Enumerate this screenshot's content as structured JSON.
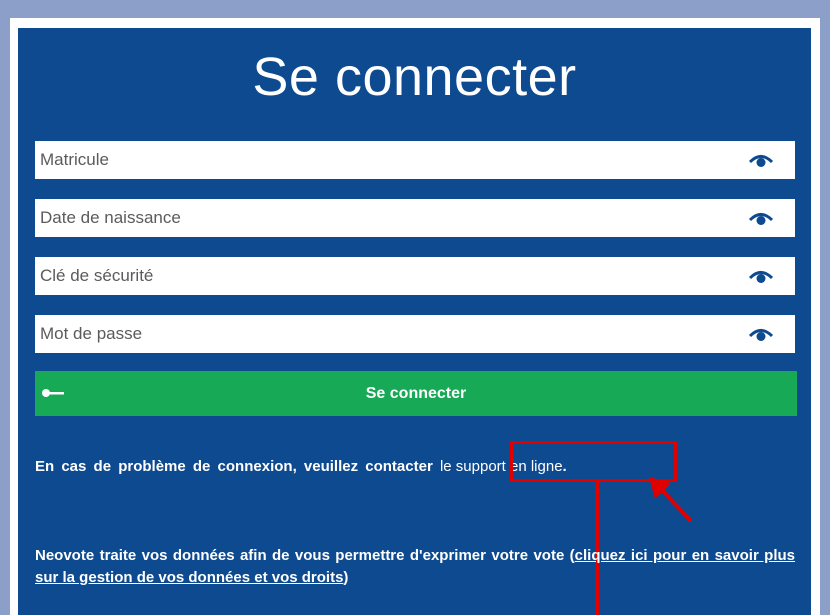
{
  "login": {
    "title": "Se connecter",
    "fields": [
      {
        "placeholder": "Matricule",
        "icon": "eye-icon"
      },
      {
        "placeholder": "Date de naissance",
        "icon": "eye-icon"
      },
      {
        "placeholder": "Clé de sécurité",
        "icon": "eye-icon"
      },
      {
        "placeholder": "Mot de passe",
        "icon": "eye-icon"
      }
    ],
    "submit_label": "Se connecter",
    "submit_icon": "key-icon",
    "help_text": "En cas de problème de connexion, veuillez contacter",
    "support_link": "le support en ligne",
    "support_suffix": ".",
    "privacy_text": "Neovote traite vos données afin de vous permettre d'exprimer votre vote (",
    "privacy_link": "cliquez ici pour en savoir plus sur la gestion de vos données et vos droits",
    "privacy_suffix": ")"
  },
  "colors": {
    "background": "#8c9fc9",
    "panel": "#0e4a8f",
    "button": "#17a955",
    "annotation": "#e00000"
  }
}
